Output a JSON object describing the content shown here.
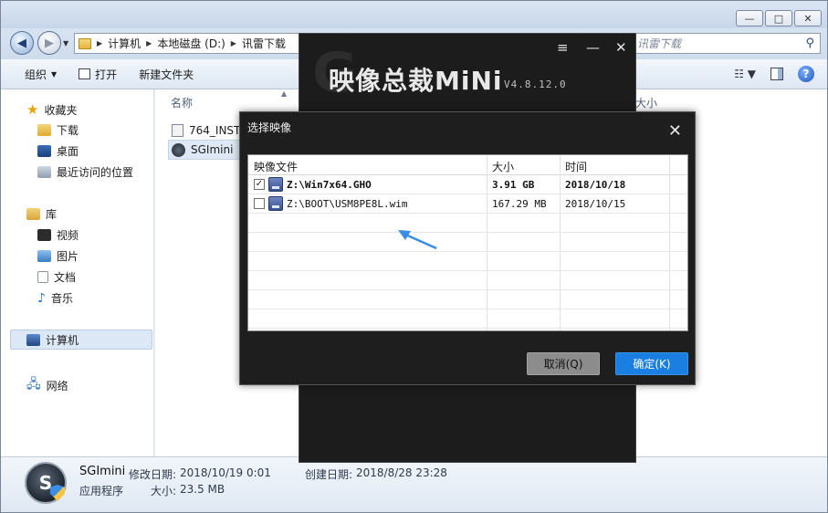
{
  "explorer": {
    "caption": {
      "minimize": "—",
      "maximize": "□",
      "close": "✕"
    },
    "breadcrumb": [
      "计算机",
      "本地磁盘 (D:)",
      "讯雷下载"
    ],
    "search_placeholder": "讯雷下载",
    "toolbar": {
      "organize": "组织",
      "open": "打开",
      "new_folder": "新建文件夹"
    },
    "nav": {
      "favorites": "收藏夹",
      "downloads": "下载",
      "desktop": "桌面",
      "recent": "最近访问的位置",
      "libraries": "库",
      "videos": "视频",
      "pictures": "图片",
      "documents": "文档",
      "music": "音乐",
      "computer": "计算机",
      "network": "网络"
    },
    "columns": {
      "name": "名称",
      "size": "大小"
    },
    "files": [
      "764_INST",
      "SGImini"
    ],
    "details": {
      "name": "SGImini",
      "type": "应用程序",
      "modified_label": "修改日期:",
      "modified": "2018/10/19 0:01",
      "created_label": "创建日期:",
      "created": "2018/8/28 23:28",
      "size_label": "大小:",
      "size": "23.5 MB"
    }
  },
  "app": {
    "title": "映像总裁MiNi",
    "version": "V4.8.12.0",
    "menu_glyph": "≡",
    "minimize_glyph": "—",
    "close_glyph": "✕"
  },
  "dialog": {
    "title": "选择映像",
    "close_glyph": "✕",
    "headers": {
      "file": "映像文件",
      "size": "大小",
      "time": "时间"
    },
    "rows": [
      {
        "checked": true,
        "path": "Z:\\Win7x64.GHO",
        "size": "3.91 GB",
        "date": "2018/10/18"
      },
      {
        "checked": false,
        "path": "Z:\\BOOT\\USM8PE8L.wim",
        "size": "167.29 MB",
        "date": "2018/10/15"
      }
    ],
    "cancel": "取消(Q)",
    "ok": "确定(K)"
  },
  "colors": {
    "accent": "#1a7fe0",
    "arrow": "#3a8de0",
    "app_bg": "#1c1c1c"
  }
}
